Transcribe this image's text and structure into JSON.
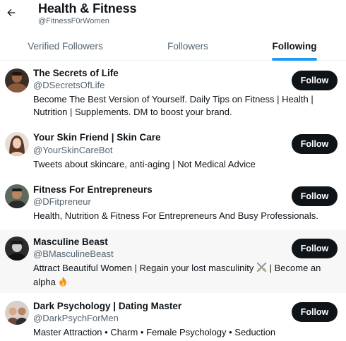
{
  "header": {
    "title": "Health & Fitness",
    "handle": "@FitnessF0rWomen"
  },
  "tabs": [
    {
      "label": "Verified Followers",
      "active": false
    },
    {
      "label": "Followers",
      "active": false
    },
    {
      "label": "Following",
      "active": true
    }
  ],
  "accent_color": "#1d9bf0",
  "users": [
    {
      "name": "The Secrets of Life",
      "handle": "@DSecretsOfLife",
      "bio": "Become The Best Version of Yourself. Daily Tips on Fitness | Health | Nutrition | Supplements. DM to boost your brand.",
      "button": "Follow"
    },
    {
      "name": "Your Skin Friend | Skin Care",
      "handle": "@YourSkinCareBot",
      "bio": "Tweets about skincare, anti-aging | Not Medical Advice",
      "button": "Follow"
    },
    {
      "name": "Fitness For Entrepreneurs",
      "handle": "@DFitpreneur",
      "bio": "Health, Nutrition & Fitness For Entrepreneurs And Busy Professionals.",
      "button": "Follow"
    },
    {
      "name": "Masculine Beast",
      "handle": "@BMasculineBeast",
      "bio_part1": "Attract Beautiful Women | Regain your lost masculinity",
      "bio_emoji1": "crossed-swords-icon",
      "bio_part2": "| Become an alpha",
      "bio_emoji2": "fire-icon",
      "button": "Follow"
    },
    {
      "name": "Dark Psychology | Dating Master",
      "handle": "@DarkPsychForMen",
      "bio": "Master Attraction • Charm • Female Psychology • Seduction",
      "button": "Follow"
    }
  ]
}
